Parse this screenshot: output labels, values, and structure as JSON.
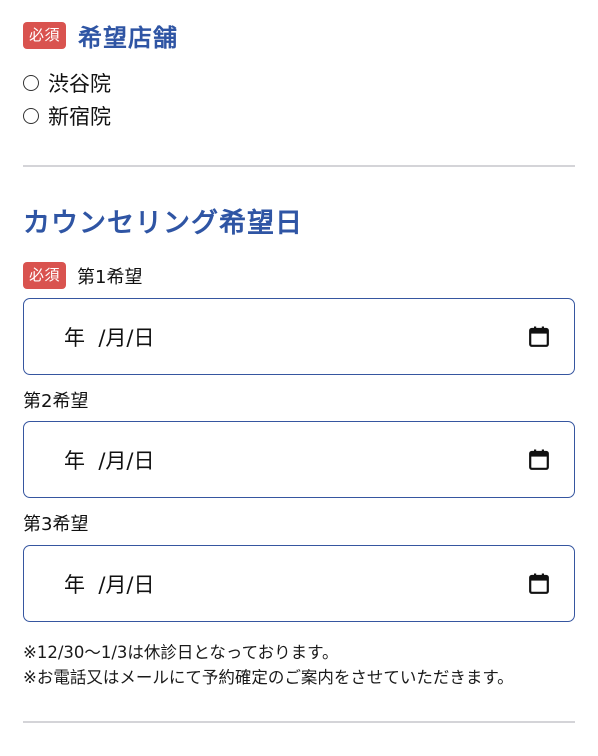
{
  "store": {
    "badge": "必須",
    "title": "希望店舗",
    "options": [
      "渋谷院",
      "新宿院"
    ]
  },
  "counseling": {
    "title": "カウンセリング希望日",
    "badge": "必須",
    "fields": [
      {
        "label": "第1希望",
        "placeholder": "年  /月/日"
      },
      {
        "label": "第2希望",
        "placeholder": "年  /月/日"
      },
      {
        "label": "第3希望",
        "placeholder": "年  /月/日"
      }
    ],
    "notes": [
      "※12/30～1/3は休診日となっております。",
      "※お電話又はメールにて予約確定のご案内をさせていただきます。"
    ]
  },
  "colors": {
    "accent": "#2f55a4",
    "badge": "#d9534f",
    "input_border": "#3656a0",
    "divider": "#d4d4d8"
  },
  "icons": {
    "radio": "radio-unchecked",
    "calendar": "calendar-icon"
  }
}
